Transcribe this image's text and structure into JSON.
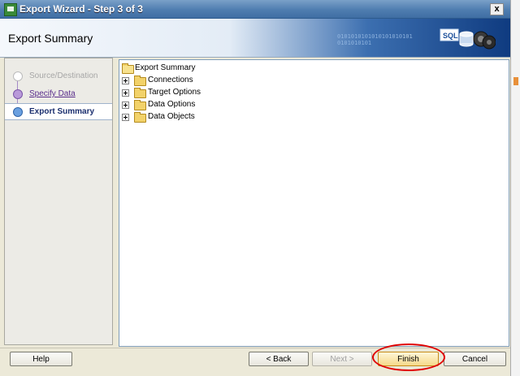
{
  "window": {
    "title": "Export Wizard - Step 3 of 3",
    "close_glyph": "x",
    "icon": "export-app-icon"
  },
  "header": {
    "title": "Export Summary",
    "binary_text": "0101010101010101010101\n0101010101",
    "logo_icon": "sql-database-icon",
    "logo_text": "SQL"
  },
  "steps": [
    {
      "label": "Source/Destination",
      "state": "completed-disabled"
    },
    {
      "label": "Specify Data",
      "state": "link"
    },
    {
      "label": "Export Summary",
      "state": "current"
    }
  ],
  "tree": {
    "root": {
      "label": "Export Summary",
      "icon": "folder-open-icon"
    },
    "children": [
      {
        "label": "Connections",
        "icon": "folder-icon"
      },
      {
        "label": "Target Options",
        "icon": "folder-icon"
      },
      {
        "label": "Data Options",
        "icon": "folder-icon"
      },
      {
        "label": "Data Objects",
        "icon": "folder-icon"
      }
    ]
  },
  "buttons": {
    "help": "Help",
    "back": "< Back",
    "next": "Next >",
    "finish": "Finish",
    "cancel": "Cancel"
  },
  "colors": {
    "titlebar": "#4f7db0",
    "accent_red_annotation": "#e00000",
    "current_step_text": "#1a2e6e"
  }
}
